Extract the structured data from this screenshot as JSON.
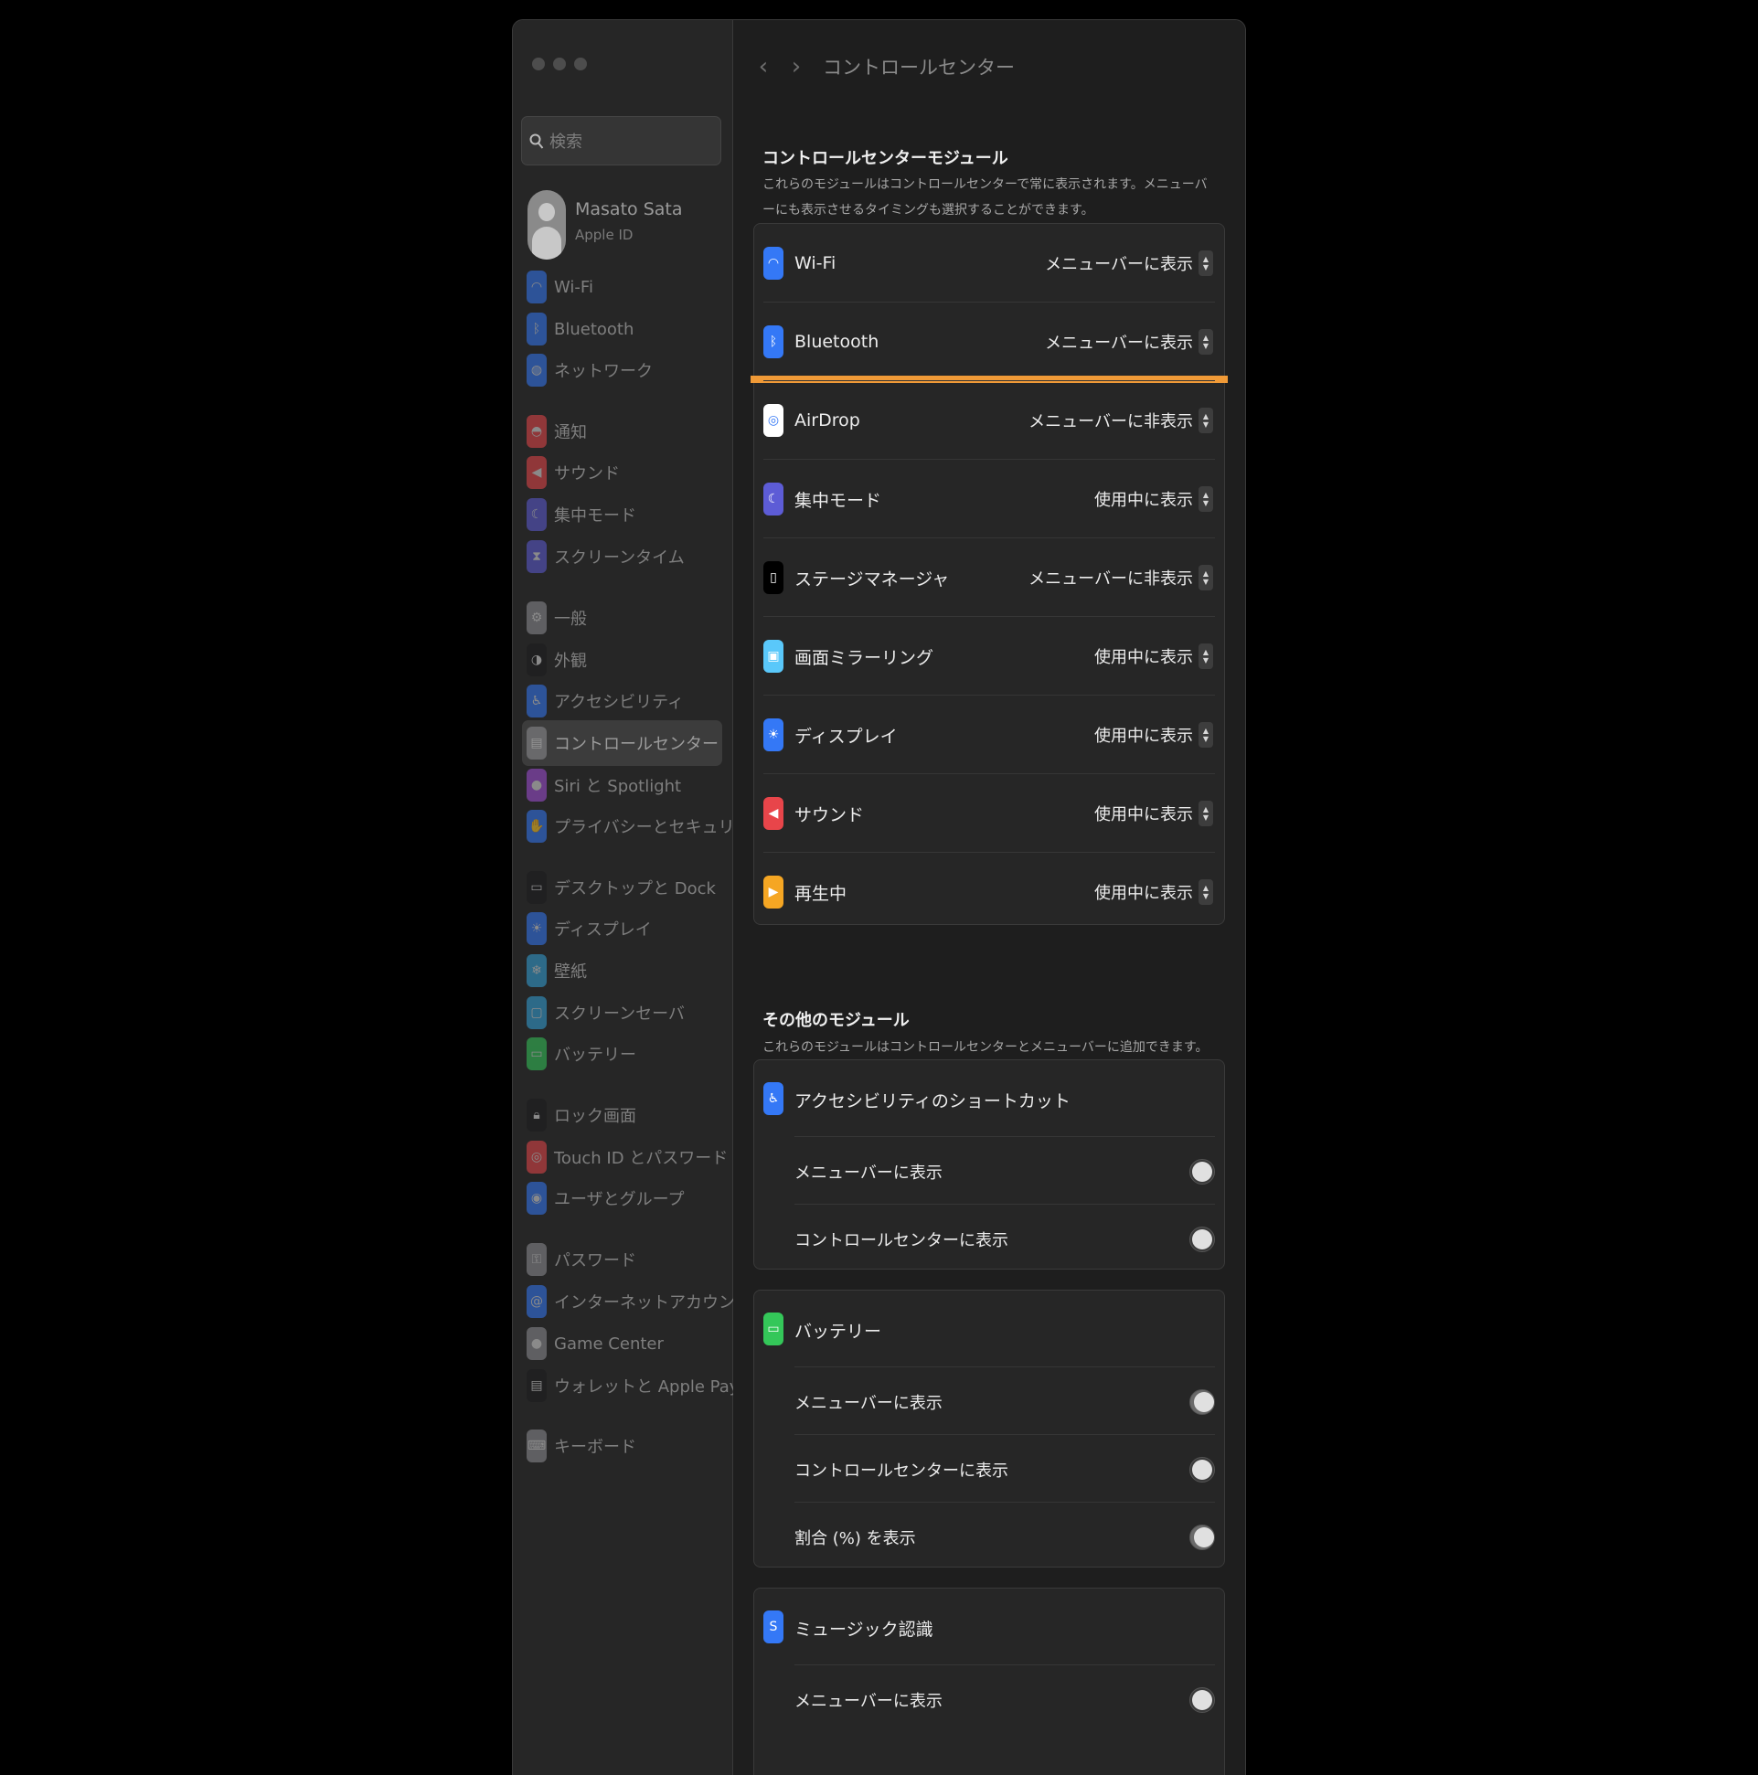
{
  "window": {
    "title": "コントロールセンター"
  },
  "search": {
    "placeholder": "検索"
  },
  "user": {
    "name": "Masato Sata",
    "subtitle": "Apple ID"
  },
  "sidebar": {
    "items": [
      {
        "label": "Wi-Fi",
        "icon": "wifi-icon",
        "color": "#3478f6"
      },
      {
        "label": "Bluetooth",
        "icon": "bluetooth-icon",
        "color": "#3478f6"
      },
      {
        "label": "ネットワーク",
        "icon": "globe-icon",
        "color": "#3478f6"
      },
      {
        "label": "通知",
        "icon": "bell-icon",
        "color": "#e8454a"
      },
      {
        "label": "サウンド",
        "icon": "speaker-icon",
        "color": "#e8454a"
      },
      {
        "label": "集中モード",
        "icon": "moon-icon",
        "color": "#5d5cd6"
      },
      {
        "label": "スクリーンタイム",
        "icon": "hourglass-icon",
        "color": "#5d5cd6"
      },
      {
        "label": "一般",
        "icon": "gear-icon",
        "color": "#8e8e93"
      },
      {
        "label": "外観",
        "icon": "appearance-icon",
        "color": "#1c1c1e"
      },
      {
        "label": "アクセシビリティ",
        "icon": "accessibility-icon",
        "color": "#3478f6"
      },
      {
        "label": "コントロールセンター",
        "icon": "control-center-icon",
        "color": "#8e8e93"
      },
      {
        "label": "Siri と Spotlight",
        "icon": "siri-icon",
        "color": "#a24fd9"
      },
      {
        "label": "プライバシーとセキュリティ",
        "icon": "hand-icon",
        "color": "#3478f6"
      },
      {
        "label": "デスクトップと Dock",
        "icon": "dock-icon",
        "color": "#1c1c1e"
      },
      {
        "label": "ディスプレイ",
        "icon": "sun-icon",
        "color": "#3478f6"
      },
      {
        "label": "壁紙",
        "icon": "wallpaper-icon",
        "color": "#33a3d9"
      },
      {
        "label": "スクリーンセーバ",
        "icon": "screensaver-icon",
        "color": "#33a3d9"
      },
      {
        "label": "バッテリー",
        "icon": "battery-icon",
        "color": "#34c759"
      },
      {
        "label": "ロック画面",
        "icon": "lock-icon",
        "color": "#1c1c1e"
      },
      {
        "label": "Touch ID とパスワード",
        "icon": "fingerprint-icon",
        "color": "#e8454a"
      },
      {
        "label": "ユーザとグループ",
        "icon": "users-icon",
        "color": "#3478f6"
      },
      {
        "label": "パスワード",
        "icon": "key-icon",
        "color": "#8e8e93"
      },
      {
        "label": "インターネットアカウント",
        "icon": "at-icon",
        "color": "#3478f6"
      },
      {
        "label": "Game Center",
        "icon": "game-center-icon",
        "color": "#8e8e93"
      },
      {
        "label": "ウォレットと Apple Pay",
        "icon": "wallet-icon",
        "color": "#1c1c1e"
      },
      {
        "label": "キーボード",
        "icon": "keyboard-icon",
        "color": "#8e8e93"
      }
    ]
  },
  "modules": {
    "title": "コントロールセンターモジュール",
    "description": "これらのモジュールはコントロールセンターで常に表示されます。メニューバーにも表示させるタイミングも選択することができます。",
    "items": [
      {
        "label": "Wi-Fi",
        "value": "メニューバーに表示",
        "icon": "wifi-icon",
        "color": "#3478f6"
      },
      {
        "label": "Bluetooth",
        "value": "メニューバーに表示",
        "icon": "bluetooth-icon",
        "color": "#3478f6"
      },
      {
        "label": "AirDrop",
        "value": "メニューバーに非表示",
        "icon": "airdrop-icon",
        "color": "#ffffff"
      },
      {
        "label": "集中モード",
        "value": "使用中に表示",
        "icon": "moon-icon",
        "color": "#5d5cd6"
      },
      {
        "label": "ステージマネージャ",
        "value": "メニューバーに非表示",
        "icon": "stage-manager-icon",
        "color": "#000000"
      },
      {
        "label": "画面ミラーリング",
        "value": "使用中に表示",
        "icon": "screen-mirroring-icon",
        "color": "#5ac8fa"
      },
      {
        "label": "ディスプレイ",
        "value": "使用中に表示",
        "icon": "sun-icon",
        "color": "#3478f6"
      },
      {
        "label": "サウンド",
        "value": "使用中に表示",
        "icon": "speaker-icon",
        "color": "#e8454a"
      },
      {
        "label": "再生中",
        "value": "使用中に表示",
        "icon": "play-icon",
        "color": "#f5a623"
      }
    ]
  },
  "other": {
    "title": "その他のモジュール",
    "description": "これらのモジュールはコントロールセンターとメニューバーに追加できます。",
    "accessibility": {
      "label": "アクセシビリティのショートカット",
      "icon": "accessibility-icon",
      "color": "#3478f6",
      "options": [
        {
          "label": "メニューバーに表示",
          "on": false
        },
        {
          "label": "コントロールセンターに表示",
          "on": false
        }
      ]
    },
    "battery": {
      "label": "バッテリー",
      "icon": "battery-icon",
      "color": "#34c759",
      "options": [
        {
          "label": "メニューバーに表示",
          "on": true
        },
        {
          "label": "コントロールセンターに表示",
          "on": false
        },
        {
          "label": "割合 (%) を表示",
          "on": true
        }
      ]
    },
    "music": {
      "label": "ミュージック認識",
      "icon": "shazam-icon",
      "color": "#3478f6",
      "options": [
        {
          "label": "メニューバーに表示",
          "on": false
        }
      ]
    }
  },
  "highlight_color": "#f09a37"
}
